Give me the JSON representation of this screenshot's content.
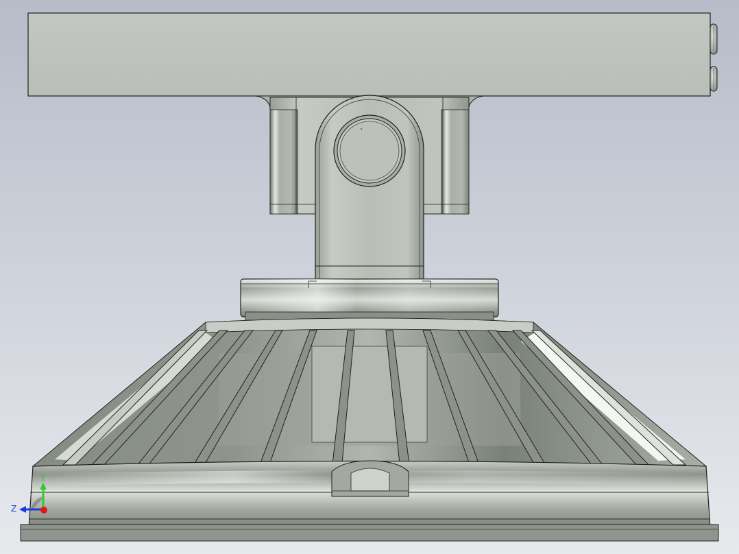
{
  "viewport": {
    "background_top": "#b6bcc8",
    "background_bottom": "#e7e9ed"
  },
  "model": {
    "body_color": "#b7bdb5",
    "edge_color": "#1e221e"
  },
  "triad": {
    "y_label": "Y",
    "z_label": "Z",
    "y_color": "#2ecc2e",
    "z_color": "#1a3ae0",
    "x_color": "#e01818"
  }
}
